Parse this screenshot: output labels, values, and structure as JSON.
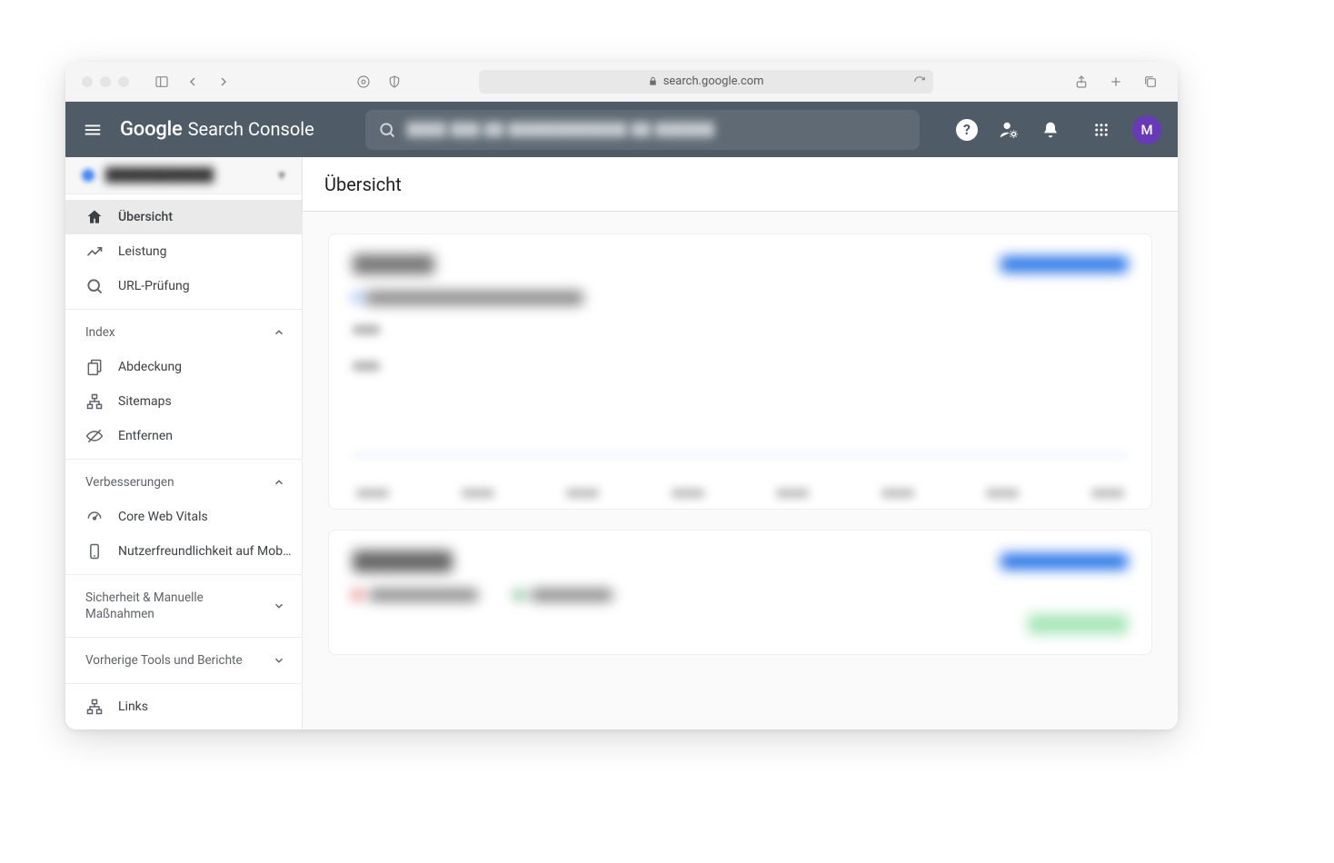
{
  "browser": {
    "url": "search.google.com"
  },
  "header": {
    "logo_google": "Google",
    "logo_product": "Search Console",
    "avatar_initial": "M"
  },
  "sidebar": {
    "nav_top": [
      {
        "label": "Übersicht",
        "icon": "home",
        "active": true
      },
      {
        "label": "Leistung",
        "icon": "trending",
        "active": false
      },
      {
        "label": "URL-Prüfung",
        "icon": "search",
        "active": false
      }
    ],
    "section_index": {
      "title": "Index",
      "items": [
        {
          "label": "Abdeckung",
          "icon": "pages"
        },
        {
          "label": "Sitemaps",
          "icon": "sitemap"
        },
        {
          "label": "Entfernen",
          "icon": "hidden"
        }
      ]
    },
    "section_enhancements": {
      "title": "Verbesserungen",
      "items": [
        {
          "label": "Core Web Vitals",
          "icon": "speed"
        },
        {
          "label": "Nutzerfreundlichkeit auf Mobil…",
          "icon": "mobile"
        }
      ]
    },
    "section_security": {
      "title": "Sicherheit & Manuelle Maßnahmen"
    },
    "section_legacy": {
      "title": "Vorherige Tools und Berichte"
    },
    "links_label": "Links"
  },
  "main": {
    "title": "Übersicht"
  }
}
